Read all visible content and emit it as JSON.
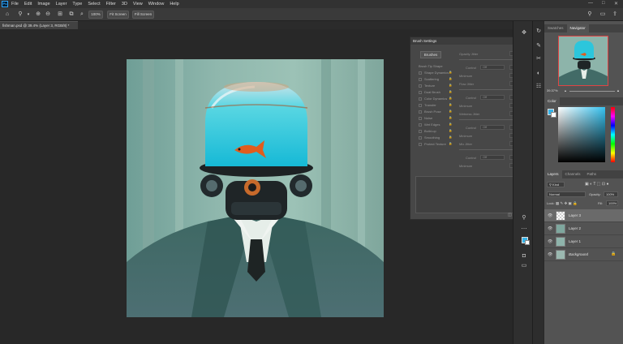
{
  "menu": [
    "File",
    "Edit",
    "Image",
    "Layer",
    "Type",
    "Select",
    "Filter",
    "3D",
    "View",
    "Window",
    "Help"
  ],
  "app_icon": "Ps",
  "window_controls": [
    "—",
    "□",
    "✕"
  ],
  "options_bar": {
    "zoom_value": "100%",
    "fit_screen_label": "Fit Screen",
    "fill_screen_label": "Fill Screen"
  },
  "document_tab": "fishman.psd @ 39.4% (Layer 3, RGB/8) *",
  "brush_settings": {
    "title": "Brush Settings",
    "brushes_button": "Brushes",
    "options": [
      "Brush Tip Shape",
      "Shape Dynamics",
      "Scattering",
      "Texture",
      "Dual Brush",
      "Color Dynamics",
      "Transfer",
      "Brush Pose",
      "Noise",
      "Wet Edges",
      "Build-up",
      "Smoothing",
      "Protect Texture"
    ],
    "right_labels": {
      "opacity_jitter": "Opacity Jitter",
      "control": "Control",
      "off": "Off",
      "minimum": "Minimum",
      "flow_jitter": "Flow Jitter",
      "wetness_jitter": "Wetness Jitter",
      "mix_jitter": "Mix Jitter"
    }
  },
  "navigator": {
    "tabs": [
      "Swatches",
      "Navigator"
    ],
    "active_tab": "Navigator",
    "zoom": "39.37%"
  },
  "color_panel": {
    "title": "Color",
    "foreground": "#35b3e8",
    "background": "#ffffff"
  },
  "layers_panel": {
    "tabs": [
      "Layers",
      "Channels",
      "Paths"
    ],
    "filter_label": "Kind",
    "blend_mode": "Normal",
    "opacity_label": "Opacity:",
    "opacity_value": "100%",
    "lock_label": "Lock:",
    "fill_label": "Fill:",
    "fill_value": "100%",
    "layers": [
      {
        "name": "Layer 3"
      },
      {
        "name": "Layer 2"
      },
      {
        "name": "Layer 1"
      },
      {
        "name": "Background"
      }
    ]
  },
  "colors": {
    "accent": "#31a8ff",
    "panel": "#535353",
    "workspace": "#282828"
  }
}
